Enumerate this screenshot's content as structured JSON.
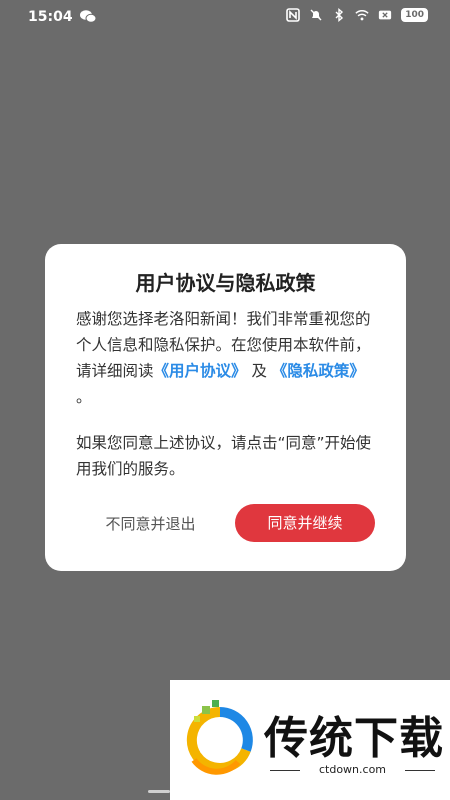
{
  "status_bar": {
    "time": "15:04",
    "battery": "100",
    "icons": [
      "wechat-icon",
      "nfc-icon",
      "mute-icon",
      "bluetooth-icon",
      "wifi-icon",
      "sim-off-icon",
      "battery-icon"
    ]
  },
  "dialog": {
    "title": "用户协议与隐私政策",
    "para1_text": "感谢您选择老洛阳新闻！我们非常重视您的个人信息和隐私保护。在您使用本软件前，请详细阅读",
    "link_user_agreement": "《用户协议》",
    "and_text": "及",
    "link_privacy_policy": "《隐私政策》",
    "period": "。",
    "para2_text": "如果您同意上述协议，请点击“同意”开始使用我们的服务。",
    "decline_label": "不同意并退出",
    "accept_label": "同意并继续"
  },
  "colors": {
    "overlay": "#6b6b6b",
    "link": "#2b8be6",
    "accept_button": "#e0373e"
  },
  "watermark": {
    "brand": "传统下载",
    "url": "ctdown.com"
  }
}
